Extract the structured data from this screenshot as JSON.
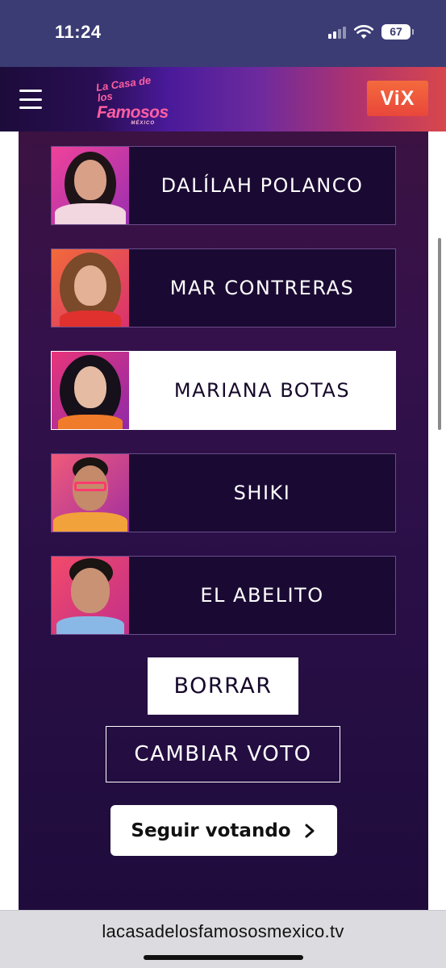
{
  "status_bar": {
    "time": "11:24",
    "battery": "67"
  },
  "header": {
    "logo_line1": "La Casa de los",
    "logo_line2": "Famosos",
    "logo_line3": "MÉXICO",
    "vix_label": "ViX"
  },
  "candidates": [
    {
      "name": "DALÍLAH POLANCO",
      "selected": false
    },
    {
      "name": "MAR CONTRERAS",
      "selected": false
    },
    {
      "name": "MARIANA BOTAS",
      "selected": true
    },
    {
      "name": "SHIKI",
      "selected": false
    },
    {
      "name": "EL ABELITO",
      "selected": false
    }
  ],
  "actions": {
    "clear_label": "BORRAR",
    "change_vote_label": "CAMBIAR VOTO",
    "continue_label": "Seguir votando"
  },
  "browser": {
    "url": "lacasadelosfamososmexico.tv"
  },
  "colors": {
    "accent_pink": "#e83e8c",
    "header_orange": "#f46a3c",
    "panel_dark": "#1a0a33"
  }
}
